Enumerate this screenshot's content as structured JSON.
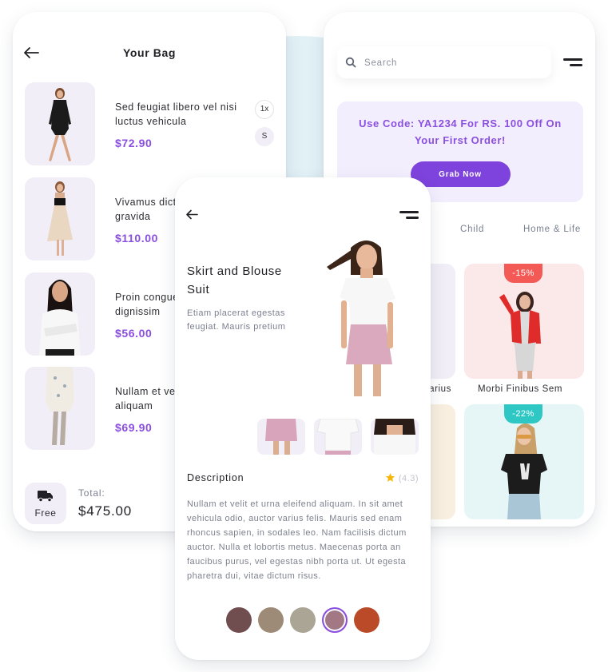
{
  "bag": {
    "title": "Your Bag",
    "items": [
      {
        "name": "Sed feugiat libero vel nisi luctus vehicula",
        "price": "$72.90",
        "qty": "1x",
        "size": "S"
      },
      {
        "name": "Vivamus dictum purus in gravida",
        "price": "$110.00"
      },
      {
        "name": "Proin congue ut est, et dignissim",
        "price": "$56.00"
      },
      {
        "name": "Nullam et velit eleifend aliquam",
        "price": "$69.90"
      }
    ],
    "shipping_label": "Free",
    "total_label": "Total:",
    "total_value": "$475.00"
  },
  "shop": {
    "search_placeholder": "Search",
    "promo_text": "Use Code: YA1234 For RS. 100 Off On Your First Order!",
    "promo_button": "Grab Now",
    "tabs": [
      "Child",
      "Home & Life"
    ],
    "products": [
      {
        "name": "Varius",
        "bg": "#f1eef7"
      },
      {
        "name": "Morbi Finibus Sem",
        "discount": "-15%",
        "bg": "#fbe8e8",
        "badge_color": "#f35a55"
      },
      {
        "name": "",
        "bg": "#f8efe0"
      },
      {
        "name": "",
        "discount": "-22%",
        "bg": "#e6f6f7",
        "badge_color": "#2ec7c4"
      }
    ]
  },
  "detail": {
    "title": "Skirt and Blouse Suit",
    "subtitle": "Etiam placerat egestas feugiat. Mauris pretium",
    "description_heading": "Description",
    "rating": "(4.3)",
    "description": "Nullam et velit et urna eleifend aliquam. In sit amet vehicula odio, auctor varius felis. Mauris sed enam rhoncus sapien, in sodales leo. Nam facilisis dictum auctor. Nulla et lobortis metus. Maecenas porta an faucibus purus, vel egestas nibh porta ut. Ut egesta pharetra dui, vitae dictum risus.",
    "colors": [
      "#704d4f",
      "#9d8a77",
      "#aba596",
      "#a27884",
      "#bb4b28"
    ],
    "selected_color_index": 3
  },
  "theme": {
    "accent": "#8a4fe0",
    "button": "#7d43dc",
    "star": "#f5b80a"
  }
}
